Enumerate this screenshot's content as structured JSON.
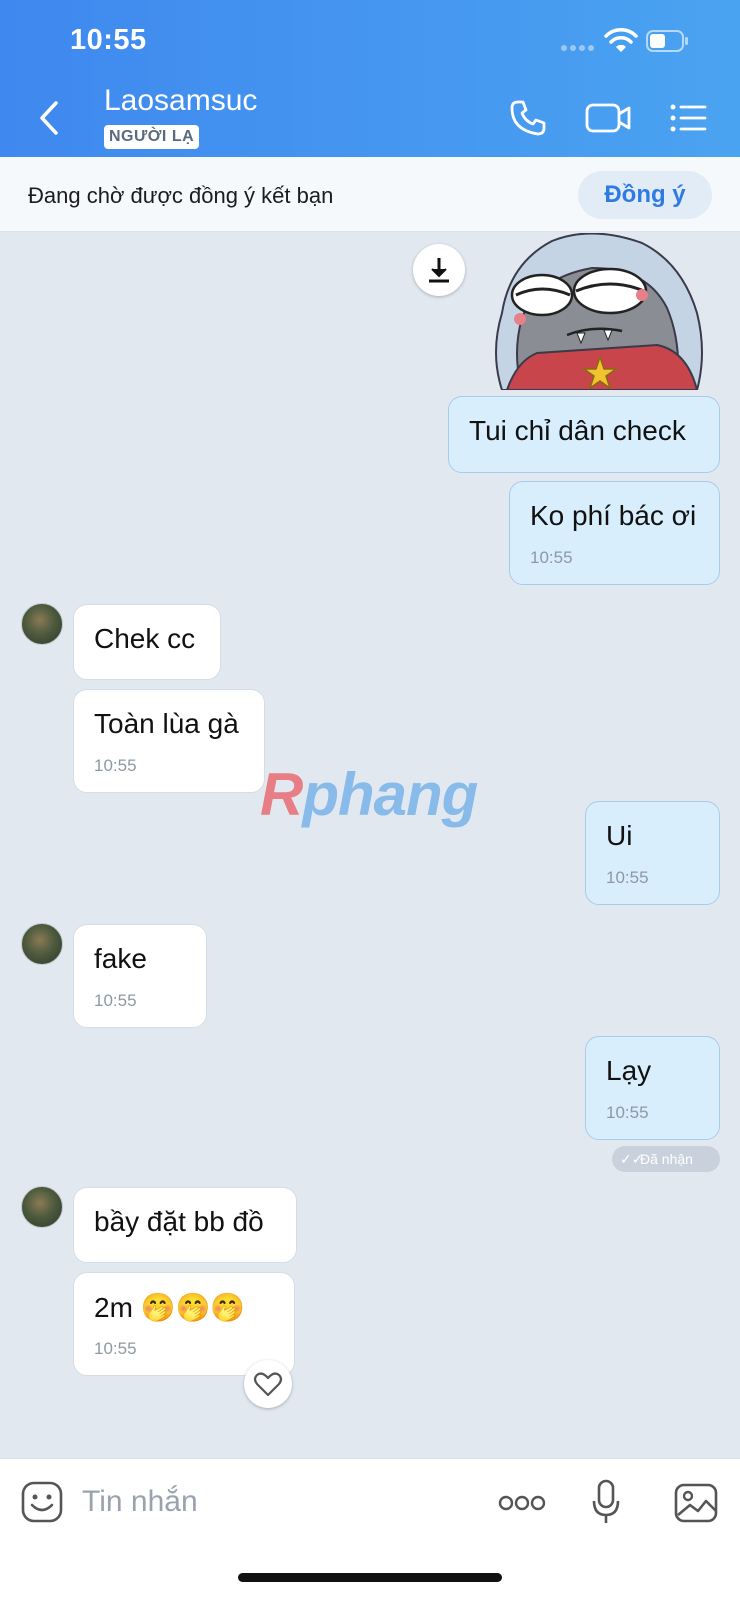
{
  "status_bar": {
    "time": "10:55"
  },
  "header": {
    "contact_name": "Laosamsuc",
    "badge": "NGƯỜI LẠ",
    "icons": [
      "back-icon",
      "phone-icon",
      "video-icon",
      "list-icon"
    ]
  },
  "friend_request": {
    "text": "Đang chờ được đồng ý kết bạn",
    "accept_label": "Đồng ý"
  },
  "messages": [
    {
      "side": "out",
      "type": "sticker"
    },
    {
      "side": "out",
      "text": "Tui chỉ dân check"
    },
    {
      "side": "out",
      "text": "Ko phí bác ơi",
      "time": "10:55"
    },
    {
      "side": "in",
      "text": "Chek cc"
    },
    {
      "side": "in",
      "text": "Toàn lùa gà",
      "time": "10:55"
    },
    {
      "side": "out",
      "text": "Ui",
      "time": "10:55"
    },
    {
      "side": "in",
      "text": "fake",
      "time": "10:55"
    },
    {
      "side": "out",
      "text": "Lạy",
      "time": "10:55"
    },
    {
      "side": "in",
      "text": "bầy đặt bb đồ"
    },
    {
      "side": "in",
      "text": "2m 🤭🤭🤭",
      "time": "10:55"
    }
  ],
  "received_status": "Đã nhận",
  "watermark": {
    "first": "R",
    "rest": "phang"
  },
  "composer": {
    "placeholder": "Tin nhắn"
  },
  "colors": {
    "header_start": "#3f88ef",
    "header_end": "#4aa3f0",
    "outgoing_bubble": "#d9eefd",
    "accent": "#2e7be6"
  }
}
